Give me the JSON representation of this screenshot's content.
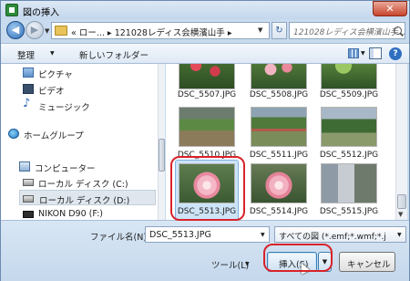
{
  "window": {
    "title": "図の挿入"
  },
  "address": {
    "path": "« ロー... ▸ 121028レディス会横濱山手 ▸",
    "search_placeholder": "121028レディス会横濱山手..."
  },
  "toolbar": {
    "organize": "整理",
    "new_folder": "新しいフォルダー"
  },
  "nav": [
    {
      "label": "ピクチャ",
      "icon": "pictures-icon"
    },
    {
      "label": "ビデオ",
      "icon": "video-icon"
    },
    {
      "label": "ミュージック",
      "icon": "music-icon"
    },
    {
      "label": "ホームグループ",
      "icon": "homegroup-icon"
    },
    {
      "label": "コンピューター",
      "icon": "computer-icon"
    },
    {
      "label": "ローカル ディスク (C:)",
      "icon": "disk-icon"
    },
    {
      "label": "ローカル ディスク (D:)",
      "icon": "disk-icon"
    },
    {
      "label": "NIKON D90 (F:)",
      "icon": "camera-icon"
    }
  ],
  "files": [
    {
      "name": "DSC_5507.JPG"
    },
    {
      "name": "DSC_5508.JPG"
    },
    {
      "name": "DSC_5509.JPG"
    },
    {
      "name": "DSC_5510.JPG"
    },
    {
      "name": "DSC_5511.JPG"
    },
    {
      "name": "DSC_5512.JPG"
    },
    {
      "name": "DSC_5513.JPG",
      "selected": true
    },
    {
      "name": "DSC_5514.JPG"
    },
    {
      "name": "DSC_5515.JPG"
    }
  ],
  "bottom": {
    "filename_label": "ファイル名(N):",
    "filename_value": "DSC_5513.JPG",
    "filetype": "すべての図 (*.emf;*.wmf;*.j",
    "tools_label": "ツール(L)",
    "insert_label": "挿入(S)",
    "cancel_label": "キャンセル"
  },
  "colors": {
    "annotation": "#d9232b",
    "selection": "#cde4f7"
  }
}
